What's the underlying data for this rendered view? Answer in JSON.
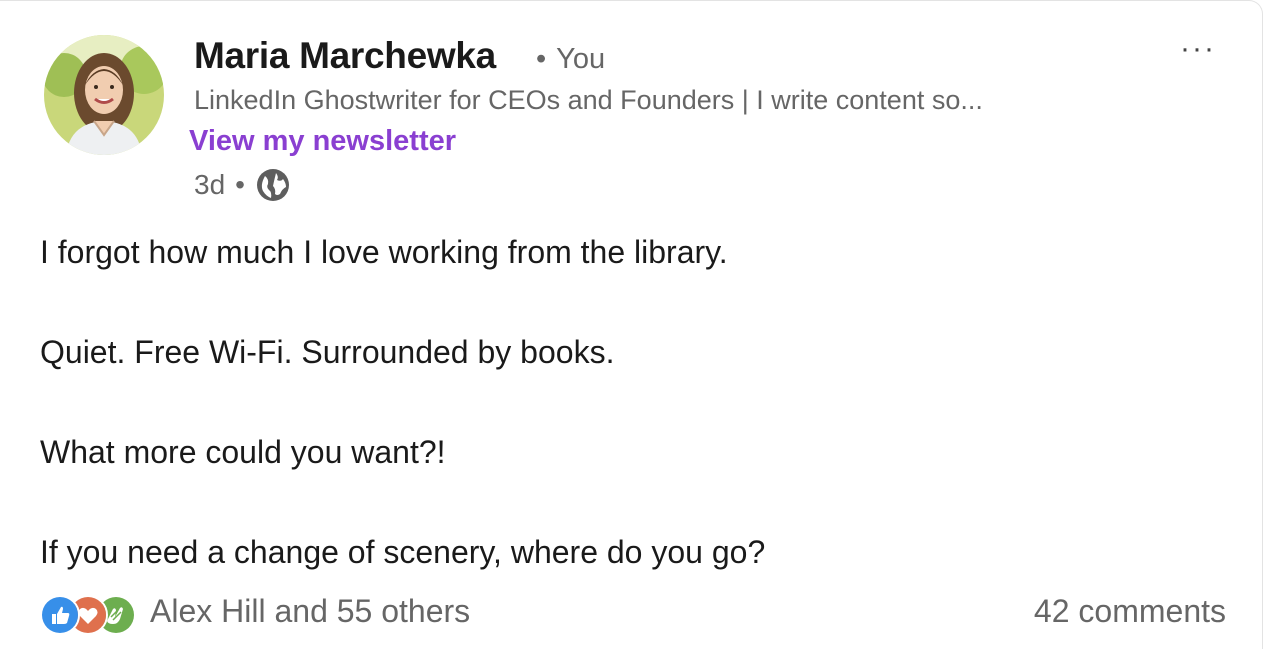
{
  "post": {
    "author": {
      "name": "Maria Marchewka",
      "relation_dot": "•",
      "relation": "You",
      "headline": "LinkedIn Ghostwriter for CEOs and Founders | I write content so...",
      "newsletter_link": "View my newsletter",
      "timestamp": "3d",
      "timestamp_sep": "•",
      "visibility_icon": "globe-icon"
    },
    "more_label": "···",
    "body": [
      "I forgot how much I love working from the library.",
      "Quiet. Free Wi-Fi. Surrounded by books.",
      "What more could you want?!",
      "If you need a change of scenery, where do you go?"
    ],
    "social": {
      "reaction_icons": [
        "like-icon",
        "love-icon",
        "celebrate-icon"
      ],
      "reactors": "Alex Hill and 55 others",
      "comments": "42 comments"
    }
  },
  "colors": {
    "newsletter_link": "#8a3fd1",
    "like": "#378fe9",
    "love": "#df704d",
    "celebrate": "#6dae4f",
    "secondary_text": "#666666"
  }
}
